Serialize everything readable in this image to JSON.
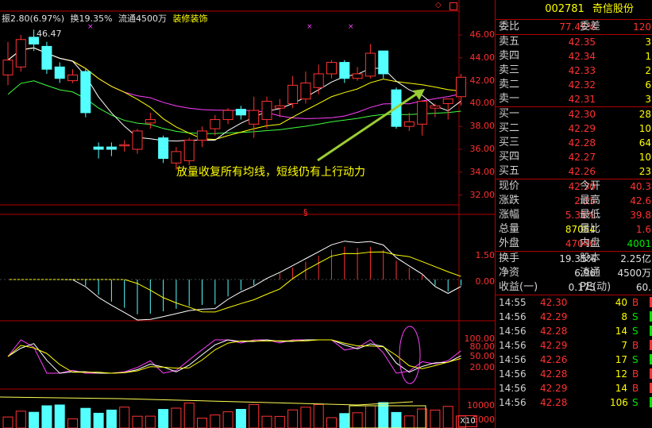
{
  "stock": {
    "code": "002781",
    "name": "奇信股份",
    "sector": "装修装饰",
    "amplitude": "振2.80(6.97%)",
    "turnover_top": "换19.35%",
    "float_top": "流通4500万"
  },
  "annotation": "放量收复所有均线，短线仍有上行动力",
  "max_label": "46.47",
  "x10_label": "X10",
  "s_marker": "§",
  "diamond": "◇",
  "price_axis": [
    "46.00",
    "44.00",
    "42.00",
    "40.00",
    "38.00",
    "36.00",
    "34.00",
    "32.00"
  ],
  "macd_axis": [
    "1.50",
    "0.00"
  ],
  "kdj_axis": [
    "100.00",
    "80.00",
    "50.00",
    "20.00"
  ],
  "vol_axis": [
    "10000",
    "5000"
  ],
  "order_book": {
    "weibi_label": "委比",
    "weibi_val": "77.45%",
    "weicha_label": "委差",
    "weicha_val": "120",
    "sells": [
      {
        "label": "卖五",
        "price": "42.35",
        "vol": "3"
      },
      {
        "label": "卖四",
        "price": "42.34",
        "vol": "1"
      },
      {
        "label": "卖三",
        "price": "42.33",
        "vol": "2"
      },
      {
        "label": "卖二",
        "price": "42.32",
        "vol": "6"
      },
      {
        "label": "卖一",
        "price": "42.31",
        "vol": "3"
      }
    ],
    "buys": [
      {
        "label": "买一",
        "price": "42.30",
        "vol": "28"
      },
      {
        "label": "买二",
        "price": "42.29",
        "vol": "10"
      },
      {
        "label": "买三",
        "price": "42.28",
        "vol": "64"
      },
      {
        "label": "买四",
        "price": "42.27",
        "vol": "10"
      },
      {
        "label": "买五",
        "price": "42.26",
        "vol": "23"
      }
    ]
  },
  "quote": [
    {
      "l1": "现价",
      "v1": "42.30",
      "c1": "red",
      "l2": "今开",
      "v2": "40.3",
      "c2": "red"
    },
    {
      "l1": "涨跌",
      "v1": "2.15",
      "c1": "red",
      "l2": "最高",
      "v2": "42.6",
      "c2": "red"
    },
    {
      "l1": "涨幅",
      "v1": "5.35%",
      "c1": "red",
      "l2": "最低",
      "v2": "39.8",
      "c2": "red"
    },
    {
      "l1": "总量",
      "v1": "87054",
      "c1": "yel",
      "l2": "量比",
      "v2": "1.6",
      "c2": "red"
    },
    {
      "l1": "外盘",
      "v1": "47040",
      "c1": "red",
      "l2": "内盘",
      "v2": "4001",
      "c2": "grn"
    }
  ],
  "fund": [
    {
      "l1": "换手",
      "v1": "19.35%",
      "l2": "股本",
      "v2": "2.25亿"
    },
    {
      "l1": "净资",
      "v1": "6.96",
      "l2": "流通",
      "v2": "4500万"
    },
    {
      "l1": "收益(一)",
      "v1": "0.175",
      "l2": "PE(动)",
      "v2": "60."
    }
  ],
  "trades": [
    {
      "time": "14:55",
      "price": "42.30",
      "qty": "40",
      "side": "B"
    },
    {
      "time": "14:56",
      "price": "42.29",
      "qty": "8",
      "side": "S"
    },
    {
      "time": "14:56",
      "price": "42.28",
      "qty": "14",
      "side": "S"
    },
    {
      "time": "14:56",
      "price": "42.29",
      "qty": "7",
      "side": "B"
    },
    {
      "time": "14:56",
      "price": "42.26",
      "qty": "17",
      "side": "S"
    },
    {
      "time": "14:56",
      "price": "42.28",
      "qty": "12",
      "side": "B"
    },
    {
      "time": "14:56",
      "price": "42.29",
      "qty": "14",
      "side": "B"
    },
    {
      "time": "14:56",
      "price": "42.28",
      "qty": "106",
      "side": "S"
    }
  ],
  "colors": {
    "up": "#ff3232",
    "down": "#54ffff",
    "grid": "#b00000",
    "bg": "#000000",
    "ma5": "#ffffff",
    "ma10": "#ffff00",
    "ma20": "#ff40ff",
    "ma60": "#40ff40"
  },
  "chart_data": [
    {
      "type": "candlestick",
      "candles": [
        [
          42.5,
          43.8,
          41.6,
          45.4
        ],
        [
          43.2,
          45.6,
          42.8,
          46.0
        ],
        [
          45.8,
          45.2,
          44.6,
          46.47
        ],
        [
          45.0,
          43.0,
          42.6,
          45.4
        ],
        [
          43.2,
          42.2,
          41.8,
          43.6
        ],
        [
          42.0,
          42.5,
          41.8,
          43.0
        ],
        [
          42.8,
          39.2,
          38.8,
          43.0
        ],
        [
          36.2,
          36.0,
          35.2,
          36.6
        ],
        [
          36.2,
          36.0,
          35.4,
          36.6
        ],
        [
          36.3,
          36.4,
          35.8,
          36.8
        ],
        [
          36.0,
          37.6,
          35.6,
          37.8
        ],
        [
          38.3,
          38.6,
          37.8,
          39.2
        ],
        [
          37.0,
          35.2,
          34.8,
          37.2
        ],
        [
          34.8,
          35.8,
          34.2,
          36.2
        ],
        [
          35.0,
          36.8,
          34.6,
          37.0
        ],
        [
          36.8,
          37.6,
          36.2,
          38.0
        ],
        [
          37.8,
          38.6,
          37.2,
          39.0
        ],
        [
          38.6,
          39.4,
          38.2,
          39.6
        ],
        [
          39.5,
          39.0,
          38.6,
          39.8
        ],
        [
          38.2,
          39.4,
          37.0,
          40.6
        ],
        [
          38.6,
          40.2,
          37.8,
          40.6
        ],
        [
          39.6,
          39.8,
          38.8,
          40.4
        ],
        [
          40.0,
          41.6,
          39.6,
          42.4
        ],
        [
          40.4,
          41.8,
          40.0,
          42.8
        ],
        [
          41.4,
          42.6,
          40.8,
          43.4
        ],
        [
          42.6,
          43.6,
          42.2,
          43.8
        ],
        [
          43.6,
          42.2,
          41.8,
          43.8
        ],
        [
          42.2,
          42.6,
          42.0,
          43.2
        ],
        [
          42.4,
          44.4,
          42.2,
          45.2
        ],
        [
          44.6,
          42.6,
          42.2,
          44.6
        ],
        [
          41.2,
          38.0,
          37.8,
          41.4
        ],
        [
          38.0,
          38.4,
          37.6,
          39.2
        ],
        [
          38.2,
          40.2,
          37.2,
          40.2
        ],
        [
          39.6,
          39.8,
          38.8,
          40.0
        ],
        [
          40.0,
          40.4,
          38.6,
          40.2
        ],
        [
          40.6,
          42.3,
          39.8,
          42.6
        ]
      ],
      "ylim": [
        32,
        47
      ]
    }
  ]
}
